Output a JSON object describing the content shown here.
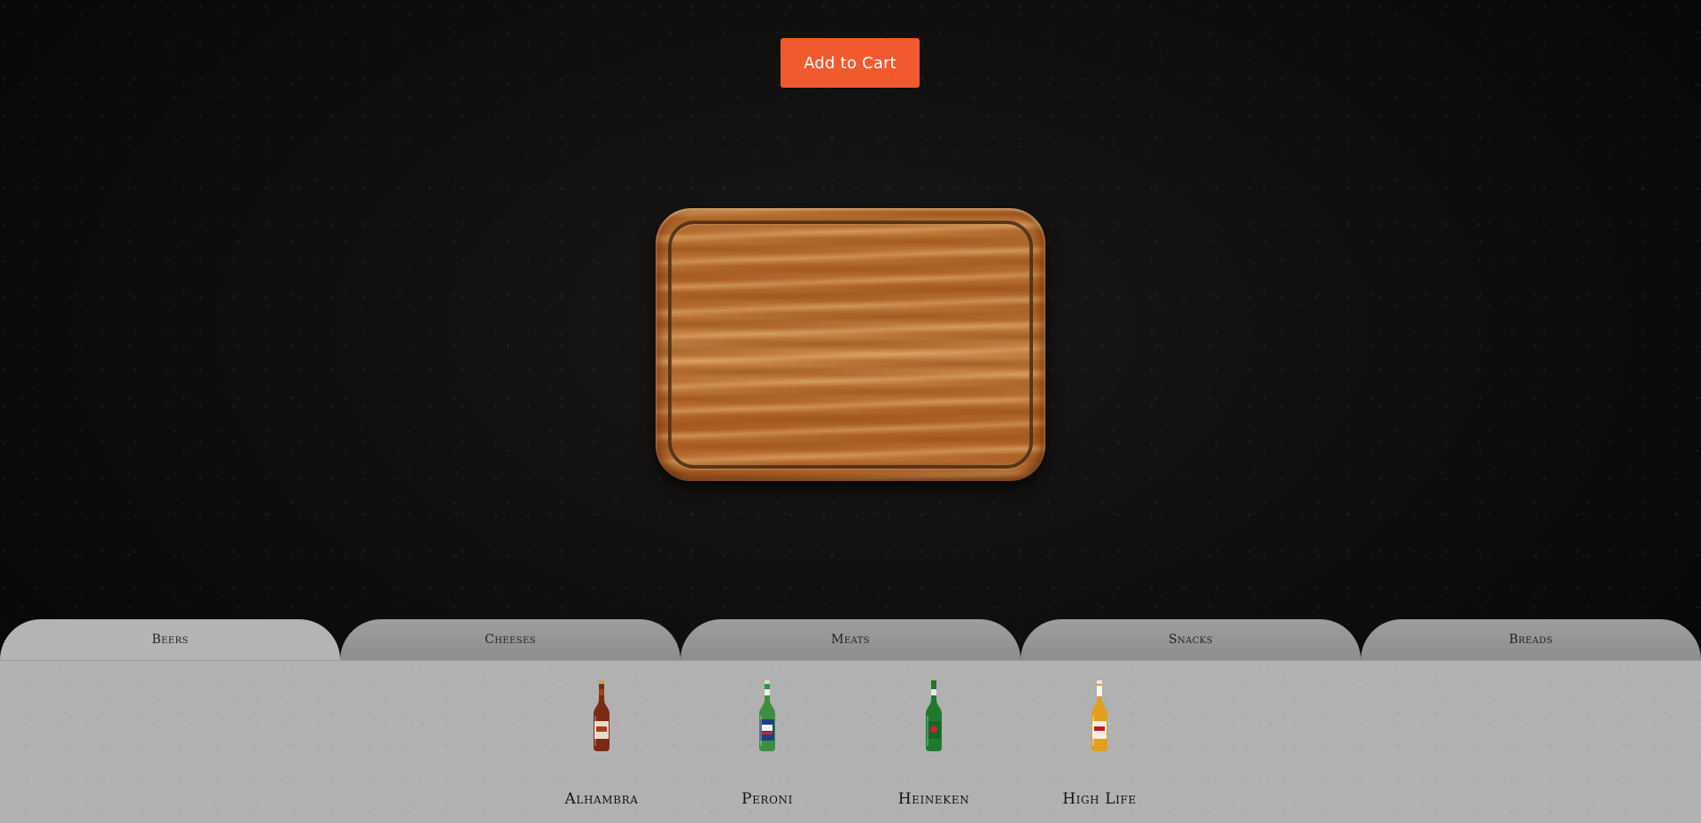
{
  "cart": {
    "button_label": "Add to Cart",
    "accent_color": "#f15a2e"
  },
  "board": {
    "icon": "cutting-board"
  },
  "tabs": [
    {
      "label": "Beers",
      "active": true
    },
    {
      "label": "Cheeses",
      "active": false
    },
    {
      "label": "Meats",
      "active": false
    },
    {
      "label": "Snacks",
      "active": false
    },
    {
      "label": "Breads",
      "active": false
    }
  ],
  "products": [
    {
      "name": "Alhambra",
      "icon": "beer-bottle-icon",
      "color": "#b23a1e"
    },
    {
      "name": "Peroni",
      "icon": "beer-bottle-icon",
      "color": "#2f8a3a"
    },
    {
      "name": "Heineken",
      "icon": "beer-bottle-icon",
      "color": "#1f7a2e"
    },
    {
      "name": "High Life",
      "icon": "beer-bottle-icon",
      "color": "#e0a01e"
    }
  ]
}
